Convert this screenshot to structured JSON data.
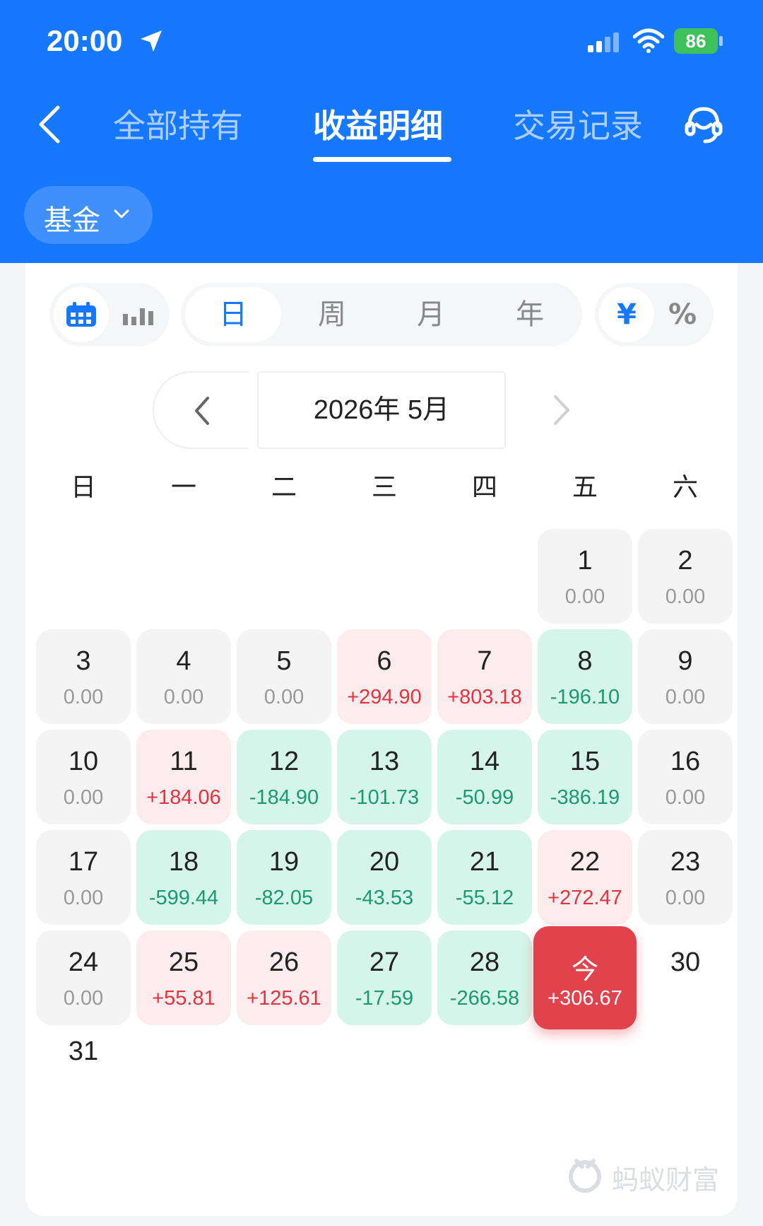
{
  "status_bar": {
    "time": "20:00",
    "battery": "86"
  },
  "nav": {
    "tabs": [
      {
        "label": "全部持有"
      },
      {
        "label": "收益明细"
      },
      {
        "label": "交易记录"
      }
    ]
  },
  "filter": {
    "label": "基金"
  },
  "view_toggle": {
    "periods": [
      "日",
      "周",
      "月",
      "年"
    ],
    "units": [
      "¥",
      "%"
    ]
  },
  "month": {
    "label": "2026年 5月"
  },
  "weekdays": [
    "日",
    "一",
    "二",
    "三",
    "四",
    "五",
    "六"
  ],
  "days": [
    {
      "num": "1",
      "val": "0.00",
      "kind": "zero"
    },
    {
      "num": "2",
      "val": "0.00",
      "kind": "zero"
    },
    {
      "num": "3",
      "val": "0.00",
      "kind": "zero"
    },
    {
      "num": "4",
      "val": "0.00",
      "kind": "zero"
    },
    {
      "num": "5",
      "val": "0.00",
      "kind": "zero"
    },
    {
      "num": "6",
      "val": "+294.90",
      "kind": "pos"
    },
    {
      "num": "7",
      "val": "+803.18",
      "kind": "pos"
    },
    {
      "num": "8",
      "val": "-196.10",
      "kind": "neg"
    },
    {
      "num": "9",
      "val": "0.00",
      "kind": "zero"
    },
    {
      "num": "10",
      "val": "0.00",
      "kind": "zero"
    },
    {
      "num": "11",
      "val": "+184.06",
      "kind": "pos"
    },
    {
      "num": "12",
      "val": "-184.90",
      "kind": "neg"
    },
    {
      "num": "13",
      "val": "-101.73",
      "kind": "neg"
    },
    {
      "num": "14",
      "val": "-50.99",
      "kind": "neg"
    },
    {
      "num": "15",
      "val": "-386.19",
      "kind": "neg"
    },
    {
      "num": "16",
      "val": "0.00",
      "kind": "zero"
    },
    {
      "num": "17",
      "val": "0.00",
      "kind": "zero"
    },
    {
      "num": "18",
      "val": "-599.44",
      "kind": "neg"
    },
    {
      "num": "19",
      "val": "-82.05",
      "kind": "neg"
    },
    {
      "num": "20",
      "val": "-43.53",
      "kind": "neg"
    },
    {
      "num": "21",
      "val": "-55.12",
      "kind": "neg"
    },
    {
      "num": "22",
      "val": "+272.47",
      "kind": "pos"
    },
    {
      "num": "23",
      "val": "0.00",
      "kind": "zero"
    },
    {
      "num": "24",
      "val": "0.00",
      "kind": "zero"
    },
    {
      "num": "25",
      "val": "+55.81",
      "kind": "pos"
    },
    {
      "num": "26",
      "val": "+125.61",
      "kind": "pos"
    },
    {
      "num": "27",
      "val": "-17.59",
      "kind": "neg"
    },
    {
      "num": "28",
      "val": "-266.58",
      "kind": "neg"
    },
    {
      "num": "今",
      "val": "+306.67",
      "kind": "today"
    },
    {
      "num": "30",
      "val": "",
      "kind": "blank"
    },
    {
      "num": "31",
      "val": "",
      "kind": "blank"
    }
  ],
  "watermark": {
    "text": "蚂蚁财富"
  },
  "colors": {
    "brand_blue": "#1677ff",
    "gain_red": "#e1343f",
    "loss_green": "#1a9a6e",
    "today_red": "#e1434d"
  }
}
